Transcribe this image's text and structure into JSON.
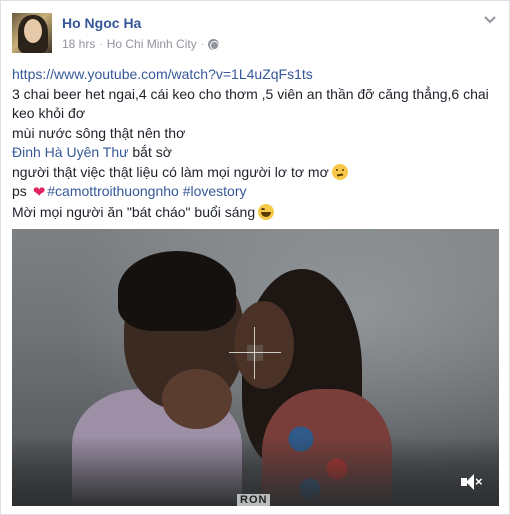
{
  "post": {
    "author": "Ho Ngoc Ha",
    "time": "18 hrs",
    "location": "Ho Chi Minh City",
    "privacy_icon": "globe-icon",
    "menu_icon": "chevron-down-icon",
    "link": "https://www.youtube.com/watch?v=1L4uZqFs1ts",
    "line1": "3 chai beer het ngai,4 cái keo cho thơm ,5 viên an thần đỡ căng thẳng,6 chai keo khỏi đơ",
    "line2": "mùi nước sông thật nên thơ",
    "mention": "Đinh Hà Uyên Thư",
    "line3_after_mention": " bắt sờ",
    "line4": "người thật việc thật liệu có làm mọi người lơ tơ mơ",
    "ps_prefix": "ps ",
    "hashtags": "#camottroithuongnho #lovestory",
    "line6": "Mời mọi người ăn \"bát cháo\" buổi sáng",
    "emoji_thinking": "thinking-face-icon",
    "emoji_laughing": "laughing-face-icon",
    "heart_glyph": "❤"
  },
  "video": {
    "mute_icon": "mute-icon",
    "mute_glyph": "×",
    "bottom_mark": "RON"
  },
  "colors": {
    "link": "#365899",
    "meta": "#90949c",
    "text": "#1d2129",
    "heart": "#e0245e"
  }
}
